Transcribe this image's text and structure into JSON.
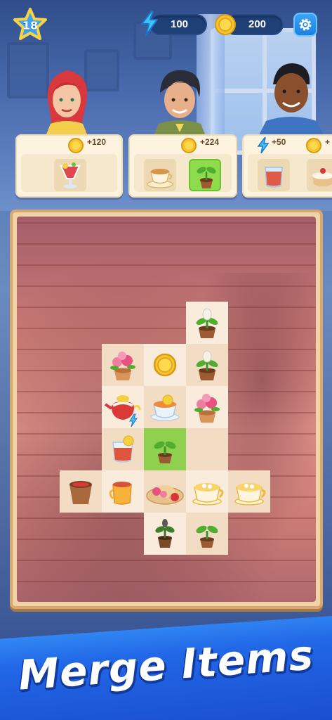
{
  "hud": {
    "level": "18",
    "energy": "100",
    "coins": "200"
  },
  "orders": [
    {
      "character": "red-haired woman",
      "reward_icon": "coin-icon",
      "reward_value": "+120",
      "items": [
        {
          "icon": "fruit-cocktail-icon",
          "ready": false
        }
      ]
    },
    {
      "character": "dark-haired man",
      "reward_icon": "coin-icon",
      "reward_value": "+224",
      "items": [
        {
          "icon": "tea-cup-icon",
          "ready": false
        },
        {
          "icon": "seedling-pot-icon",
          "ready": true
        }
      ]
    },
    {
      "character": "man in blue shirt",
      "reward_icon": "energy-icon",
      "reward_value": "+50",
      "reward2_icon": "coin-icon",
      "reward2_value": "+",
      "items": [
        {
          "icon": "tea-glass-icon",
          "ready": false
        },
        {
          "icon": "cake-icon",
          "ready": false
        }
      ]
    }
  ],
  "board": {
    "cells": [
      {
        "row": 0,
        "col": 4,
        "item": "sprout-bud-pot-icon"
      },
      {
        "row": 1,
        "col": 2,
        "item": "rose-pot-icon"
      },
      {
        "row": 1,
        "col": 3,
        "item": "coin-icon"
      },
      {
        "row": 1,
        "col": 4,
        "item": "sprout-bud-pot-icon"
      },
      {
        "row": 2,
        "col": 2,
        "item": "teapot-energy-icon"
      },
      {
        "row": 2,
        "col": 3,
        "item": "lemon-tea-cup-icon"
      },
      {
        "row": 2,
        "col": 4,
        "item": "rose-pot-icon"
      },
      {
        "row": 3,
        "col": 2,
        "item": "lemon-tea-glass-icon"
      },
      {
        "row": 3,
        "col": 3,
        "item": "seedling-pot-icon"
      },
      {
        "row": 3,
        "col": 4,
        "item": ""
      },
      {
        "row": 4,
        "col": 1,
        "item": "empty-pot-icon"
      },
      {
        "row": 4,
        "col": 2,
        "item": "tea-mug-icon"
      },
      {
        "row": 4,
        "col": 3,
        "item": "rose-hat-icon"
      },
      {
        "row": 4,
        "col": 4,
        "item": "cappuccino-icon"
      },
      {
        "row": 4,
        "col": 5,
        "item": "cappuccino-icon"
      },
      {
        "row": 5,
        "col": 3,
        "item": "sprout-pot-icon"
      },
      {
        "row": 5,
        "col": 4,
        "item": "seedling-pot-icon"
      }
    ]
  },
  "banner": {
    "title": "Merge Items"
  },
  "colors": {
    "accent_blue": "#2167e6",
    "board_brick": "#e4948a",
    "ready_green": "#8fd14f",
    "coin_gold": "#f7c531"
  }
}
